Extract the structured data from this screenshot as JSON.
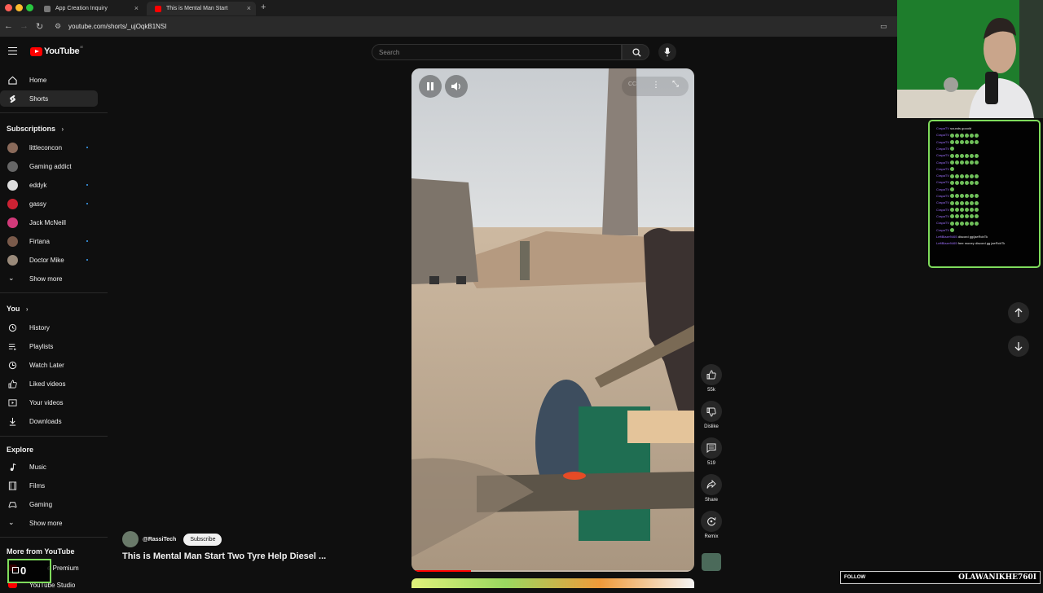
{
  "browser": {
    "tabs": [
      {
        "label": "App Creation Inquiry"
      },
      {
        "label": "This is Mental Man Start"
      }
    ],
    "url": "youtube.com/shorts/_ujOqkB1NSI"
  },
  "youtube": {
    "logo_text": "YouTube",
    "region_badge": "IE",
    "search_placeholder": "Search"
  },
  "sidebar": {
    "main": [
      {
        "label": "Home",
        "icon": "home-icon"
      },
      {
        "label": "Shorts",
        "icon": "shorts-icon",
        "active": true
      }
    ],
    "subscriptions_title": "Subscriptions",
    "subscriptions": [
      {
        "label": "littleconcon",
        "color": "#8a6a5a",
        "new": true
      },
      {
        "label": "Gaming addict",
        "color": "#666666",
        "new": false
      },
      {
        "label": "eddyk",
        "color": "#dddddd",
        "new": true
      },
      {
        "label": "gassy",
        "color": "#cc2233",
        "new": true
      },
      {
        "label": "Jack McNeill",
        "color": "#d23a7a",
        "new": false
      },
      {
        "label": "Firtana",
        "color": "#7a5a4a",
        "new": true
      },
      {
        "label": "Doctor Mike",
        "color": "#9a8a7a",
        "new": true
      }
    ],
    "show_more": "Show more",
    "you_title": "You",
    "you": [
      {
        "label": "History",
        "icon": "history-icon"
      },
      {
        "label": "Playlists",
        "icon": "playlists-icon"
      },
      {
        "label": "Watch Later",
        "icon": "watch-later-icon"
      },
      {
        "label": "Liked videos",
        "icon": "liked-icon"
      },
      {
        "label": "Your videos",
        "icon": "your-videos-icon"
      },
      {
        "label": "Downloads",
        "icon": "downloads-icon"
      }
    ],
    "explore_title": "Explore",
    "explore": [
      {
        "label": "Music",
        "icon": "music-icon"
      },
      {
        "label": "Films",
        "icon": "films-icon"
      },
      {
        "label": "Gaming",
        "icon": "gaming-icon"
      }
    ],
    "explore_show_more": "Show more",
    "more_title": "More from YouTube",
    "more": [
      {
        "label": "e Premium"
      },
      {
        "label": "YouTube Studio"
      }
    ]
  },
  "short": {
    "channel": "@RassiTech",
    "subscribe": "Subscribe",
    "title": "This is Mental Man Start Two Tyre Help Diesel ...",
    "actions": [
      {
        "label": "55k",
        "icon": "like-icon"
      },
      {
        "label": "Dislike",
        "icon": "dislike-icon"
      },
      {
        "label": "519",
        "icon": "comment-icon"
      },
      {
        "label": "Share",
        "icon": "share-icon"
      },
      {
        "label": "Remix",
        "icon": "remix-icon"
      }
    ],
    "progress": 0.21
  },
  "stream_overlay": {
    "follow_label": "FOLLOW",
    "follow_name": "OLAWANIKHE760I",
    "counter": "0",
    "chat": [
      {
        "user": "CrapaTV",
        "msg": "sounds gooold"
      },
      {
        "user": "CrapaTV",
        "msg": ""
      },
      {
        "user": "CrapaTV",
        "msg": ""
      },
      {
        "user": "CrapaTV",
        "msg": ""
      },
      {
        "user": "CrapaTV",
        "msg": ""
      },
      {
        "user": "CrapaTV",
        "msg": ""
      },
      {
        "user": "CrapaTV",
        "msg": ""
      },
      {
        "user": "CrapaTV",
        "msg": ""
      },
      {
        "user": "CrapaTV",
        "msg": ""
      },
      {
        "user": "CrapaTV",
        "msg": ""
      },
      {
        "user": "CrapaTV",
        "msg": ""
      },
      {
        "user": "CrapaTV",
        "msg": ""
      },
      {
        "user": "CrapaTV",
        "msg": ""
      },
      {
        "user": "CrapaTV",
        "msg": ""
      },
      {
        "user": "CrapaTV",
        "msg": ""
      },
      {
        "user": "CrapaTV",
        "msg": ""
      },
      {
        "user": "LeftBlaze9465",
        "msg": "discord gg/jaeRcbTk"
      },
      {
        "user": "LeftBlaze9465",
        "msg": "free money discord gg jaeRcbTk"
      }
    ]
  }
}
